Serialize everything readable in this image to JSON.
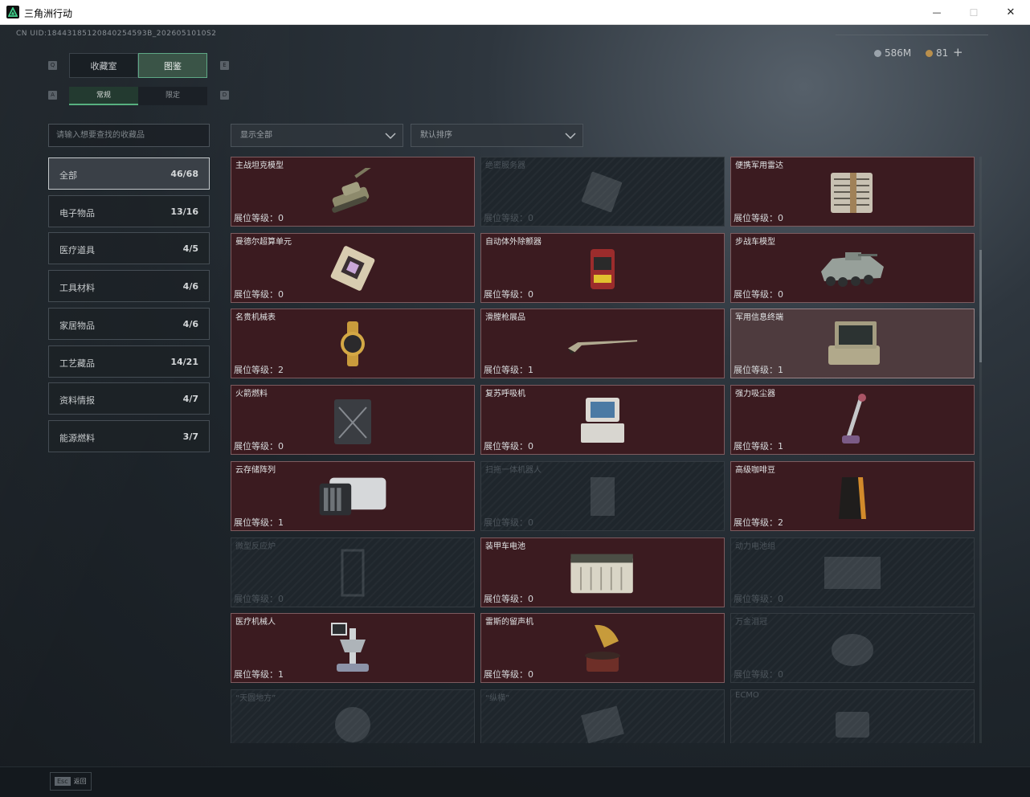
{
  "window": {
    "title": "三角洲行动",
    "minimize": "—",
    "maximize": "☐",
    "close": "✕"
  },
  "uid": "CN UID:18443185120840254593B_2026051010S2",
  "currency": {
    "a": "586M",
    "b": "81",
    "plus": "+",
    "a_color": "#9aa3ab",
    "b_color": "#b98f4c"
  },
  "tabs": [
    {
      "label": "收藏室"
    },
    {
      "label": "图鉴"
    }
  ],
  "tab_keys": {
    "left": "Q",
    "right": "E"
  },
  "subtabs": [
    {
      "label": "常规"
    },
    {
      "label": "限定"
    }
  ],
  "subtab_keys": {
    "left": "A",
    "right": "D"
  },
  "search": {
    "placeholder": "请输入想要查找的收藏品"
  },
  "filter": {
    "value": "显示全部"
  },
  "sort": {
    "value": "默认排序"
  },
  "categories": [
    {
      "label": "全部",
      "count": "46/68"
    },
    {
      "label": "电子物品",
      "count": "13/16"
    },
    {
      "label": "医疗道具",
      "count": "4/5"
    },
    {
      "label": "工具材料",
      "count": "4/6"
    },
    {
      "label": "家居物品",
      "count": "4/6"
    },
    {
      "label": "工艺藏品",
      "count": "14/21"
    },
    {
      "label": "资料情报",
      "count": "4/7"
    },
    {
      "label": "能源燃料",
      "count": "3/7"
    }
  ],
  "items": [
    {
      "name": "主战坦克模型",
      "level": "展位等级：0",
      "icon": "tank-icon"
    },
    {
      "name": "绝密服务器",
      "level": "展位等级：0",
      "icon": "server-icon"
    },
    {
      "name": "便携军用雷达",
      "level": "展位等级：0",
      "icon": "radar-icon"
    },
    {
      "name": "曼德尔超算单元",
      "level": "展位等级：0",
      "icon": "chip-icon"
    },
    {
      "name": "自动体外除颤器",
      "level": "展位等级：0",
      "icon": "defibrillator-icon"
    },
    {
      "name": "步战车模型",
      "level": "展位等级：0",
      "icon": "ifv-icon"
    },
    {
      "name": "名贵机械表",
      "level": "展位等级：2",
      "icon": "watch-icon"
    },
    {
      "name": "滑膛枪展品",
      "level": "展位等级：1",
      "icon": "musket-icon"
    },
    {
      "name": "军用信息终端",
      "level": "展位等级：1",
      "icon": "terminal-icon"
    },
    {
      "name": "火箭燃料",
      "level": "展位等级：0",
      "icon": "fuel-can-icon"
    },
    {
      "name": "复苏呼吸机",
      "level": "展位等级：0",
      "icon": "ventilator-icon"
    },
    {
      "name": "强力吸尘器",
      "level": "展位等级：1",
      "icon": "vacuum-icon"
    },
    {
      "name": "云存储阵列",
      "level": "展位等级：1",
      "icon": "storage-array-icon"
    },
    {
      "name": "扫拖一体机器人",
      "level": "展位等级：0",
      "icon": "robot-icon"
    },
    {
      "name": "高级咖啡豆",
      "level": "展位等级：2",
      "icon": "coffee-bag-icon"
    },
    {
      "name": "微型反应炉",
      "level": "展位等级：0",
      "icon": "reactor-icon"
    },
    {
      "name": "装甲车电池",
      "level": "展位等级：0",
      "icon": "battery-icon"
    },
    {
      "name": "动力电池组",
      "level": "展位等级：0",
      "icon": "battery-pack-icon"
    },
    {
      "name": "医疗机械人",
      "level": "展位等级：1",
      "icon": "medical-robot-icon"
    },
    {
      "name": "雷斯的留声机",
      "level": "展位等级：0",
      "icon": "gramophone-icon"
    },
    {
      "name": "万金泪冠",
      "level": "展位等级：0",
      "icon": "crown-icon"
    },
    {
      "name": "“天圆地方”",
      "level": "",
      "icon": "globe-icon"
    },
    {
      "name": "“纵横”",
      "level": "",
      "icon": "board-icon"
    },
    {
      "name": "ECMO",
      "level": "",
      "icon": "ecmo-icon"
    }
  ],
  "footer": {
    "key": "Esc",
    "label": "返回"
  }
}
